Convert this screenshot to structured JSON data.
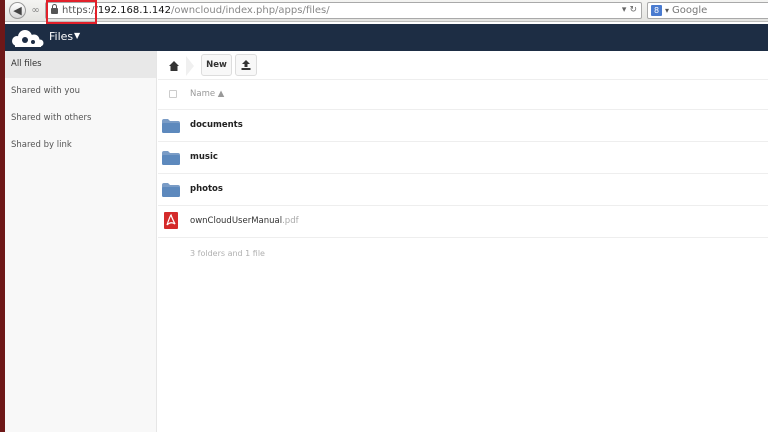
{
  "browser": {
    "url_scheme": "https://",
    "url_host": "192.168.1.142",
    "url_path": "/owncloud/index.php/apps/files/",
    "search_placeholder": "Google",
    "search_engine_icon": "google-search-icon"
  },
  "header": {
    "app_name": "Files",
    "logo": "owncloud-logo",
    "colors": {
      "header_bg": "#1d2d44",
      "highlight": "#e2202a"
    }
  },
  "sidebar": {
    "items": [
      {
        "label": "All files",
        "active": true
      },
      {
        "label": "Shared with you",
        "active": false
      },
      {
        "label": "Shared with others",
        "active": false
      },
      {
        "label": "Shared by link",
        "active": false
      }
    ]
  },
  "toolbar": {
    "new_label": "New",
    "upload_icon": "upload-icon",
    "home_icon": "home-icon"
  },
  "list": {
    "header_name": "Name ▲",
    "files": [
      {
        "name": "documents",
        "ext": "",
        "type": "folder"
      },
      {
        "name": "music",
        "ext": "",
        "type": "folder"
      },
      {
        "name": "photos",
        "ext": "",
        "type": "folder"
      },
      {
        "name": "ownCloudUserManual",
        "ext": ".pdf",
        "type": "pdf"
      }
    ],
    "summary": "3 folders and 1 file"
  }
}
